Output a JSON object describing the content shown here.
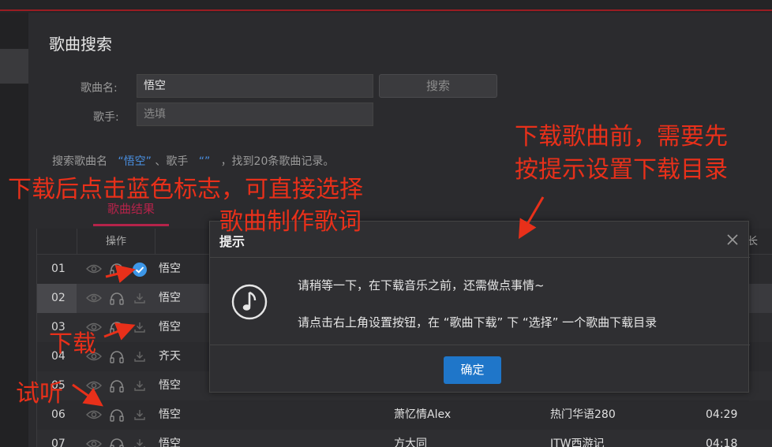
{
  "page": {
    "title": "歌曲搜索"
  },
  "search_form": {
    "song_name_label": "歌曲名:",
    "song_name_value": "悟空",
    "singer_label": "歌手:",
    "singer_placeholder": "选填",
    "search_button": "搜索"
  },
  "summary": {
    "prefix": "搜索歌曲名",
    "song_quoted": "“悟空”",
    "mid": "、歌手",
    "singer_quoted": "“”",
    "suffix": "，找到20条歌曲记录。"
  },
  "tabs": {
    "results": "歌曲结果"
  },
  "table": {
    "op_header": "操作",
    "duration_header_partial": "长",
    "rows": [
      {
        "num": "01",
        "title": "悟空",
        "singer": "",
        "album": "",
        "duration": ""
      },
      {
        "num": "02",
        "title": "悟空",
        "singer": "",
        "album": "",
        "duration": ""
      },
      {
        "num": "03",
        "title": "悟空",
        "singer": "",
        "album": "",
        "duration": ""
      },
      {
        "num": "04",
        "title": "齐天",
        "singer": "",
        "album": "",
        "duration": ""
      },
      {
        "num": "05",
        "title": "悟空",
        "singer": "",
        "album": "",
        "duration": ""
      },
      {
        "num": "06",
        "title": "悟空",
        "singer": "萧忆情Alex",
        "album": "热门华语280",
        "duration": "04:29"
      },
      {
        "num": "07",
        "title": "悟空",
        "singer": "方大同",
        "album": "JTW西游记",
        "duration": "04:18"
      }
    ]
  },
  "dialog": {
    "title": "提示",
    "message1": "请稍等一下，在下载音乐之前，还需做点事情~",
    "message2": "请点击右上角设置按钮，在 “歌曲下载” 下 “选择” 一个歌曲下载目录",
    "ok_button": "确定"
  },
  "annotations": {
    "before_download_line1": "下载歌曲前，需要先",
    "before_download_line2": "按提示设置下载目录",
    "after_download_line1": "下载后点击蓝色标志，可直接选择",
    "after_download_line2": "歌曲制作歌词",
    "download": "下载",
    "listen": "试听"
  },
  "colors": {
    "accent_red": "#b5234a",
    "annotation_red": "#e8301a",
    "primary_blue": "#1f76c9",
    "check_blue": "#3d97e8",
    "summary_highlight": "#4a90e2"
  },
  "icons": {
    "preview": "eye-icon",
    "listen": "headphones-icon",
    "download": "download-icon",
    "selected": "check-circle-icon",
    "close": "close-icon",
    "dialog": "music-note-icon"
  }
}
